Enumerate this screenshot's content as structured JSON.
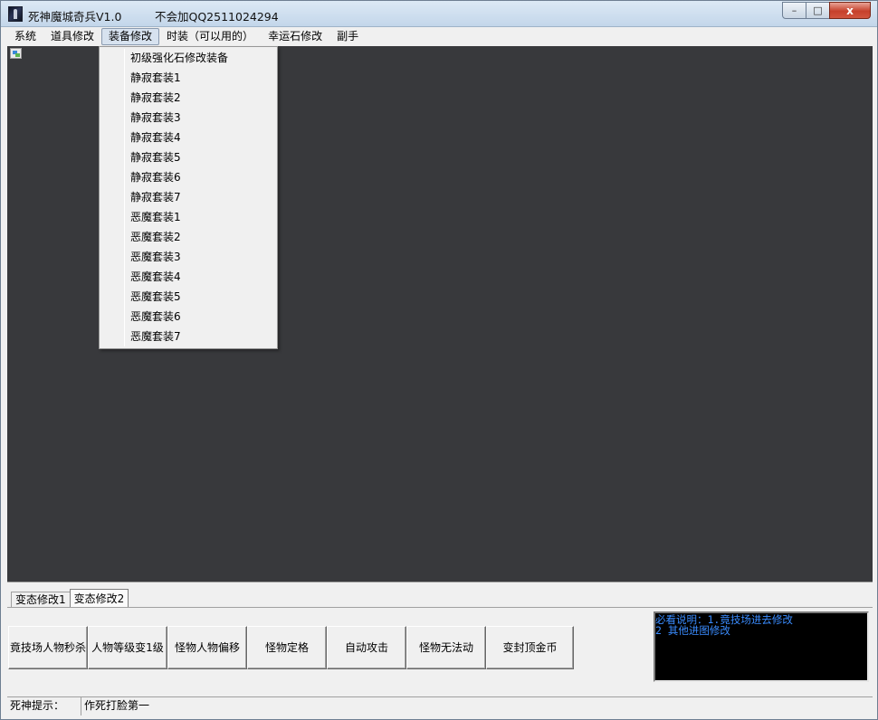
{
  "window": {
    "title": "死神魔城奇兵V1.0",
    "note": "不会加QQ2511024294",
    "controls": {
      "minimize": "–",
      "maximize": "□",
      "close": "x"
    }
  },
  "menubar": {
    "items": [
      {
        "label": "系统"
      },
      {
        "label": "道具修改"
      },
      {
        "label": "装备修改"
      },
      {
        "label": "时装（可以用的）"
      },
      {
        "label": "幸运石修改"
      },
      {
        "label": "副手"
      }
    ],
    "active_index": 2
  },
  "dropdown": {
    "items": [
      "初级强化石修改装备",
      "静寂套装1",
      "静寂套装2",
      "静寂套装3",
      "静寂套装4",
      "静寂套装5",
      "静寂套装6",
      "静寂套装7",
      "恶魔套装1",
      "恶魔套装2",
      "恶魔套装3",
      "恶魔套装4",
      "恶魔套装5",
      "恶魔套装6",
      "恶魔套装7"
    ]
  },
  "tabs": {
    "items": [
      "变态修改1",
      "变态修改2"
    ],
    "selected_index": 1
  },
  "buttons": [
    "竟技场人物秒杀",
    "人物等级变1级",
    "怪物人物偏移",
    "怪物定格",
    "自动攻击",
    "怪物无法动",
    "变封顶金币"
  ],
  "notice": {
    "lines": [
      "必看说明：1.竟技场进去修改",
      "2 其他进图修改"
    ],
    "text_color": "#3a8cff"
  },
  "status": {
    "label": "死神提示：",
    "value": "作死打脸第一"
  },
  "colors": {
    "canvas": "#38393c",
    "chrome": "#f0f0f0"
  }
}
